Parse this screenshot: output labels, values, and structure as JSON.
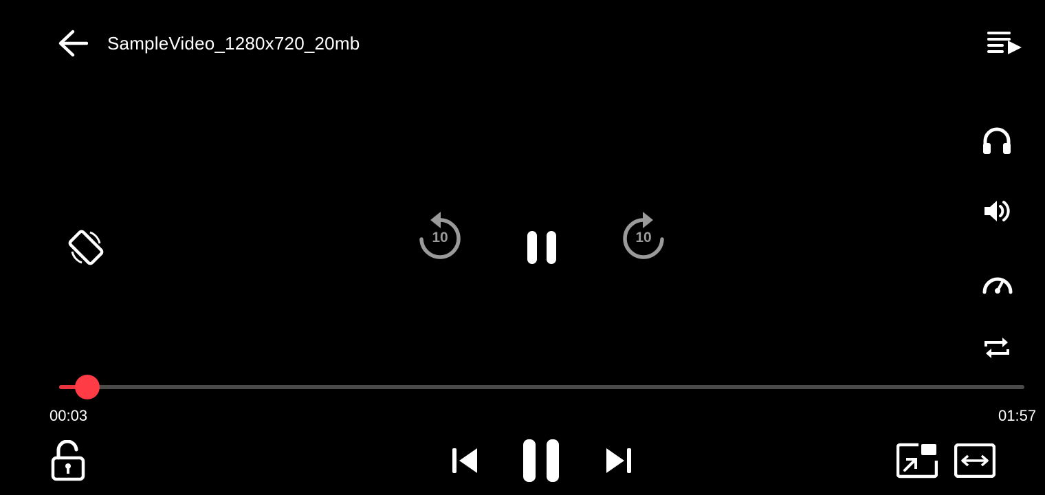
{
  "header": {
    "title": "SampleVideo_1280x720_20mb"
  },
  "playback": {
    "current_time": "00:03",
    "duration": "01:57",
    "progress_fraction": 0.0294,
    "state": "playing"
  },
  "controls": {
    "rewind_seconds": "10",
    "forward_seconds": "10"
  },
  "icons": {
    "back": "back-arrow-icon",
    "playlist": "playlist-play-icon",
    "audio_track": "headphones-icon",
    "volume": "volume-icon",
    "speed": "speedometer-icon",
    "repeat": "repeat-icon",
    "rotate": "screen-rotation-icon",
    "lock": "unlock-icon",
    "pip": "picture-in-picture-icon",
    "aspect": "aspect-ratio-icon"
  },
  "colors": {
    "background": "#000000",
    "accent": "#ff3b45",
    "track": "#4a4a4a",
    "seek_icon": "#9a9a9a"
  }
}
